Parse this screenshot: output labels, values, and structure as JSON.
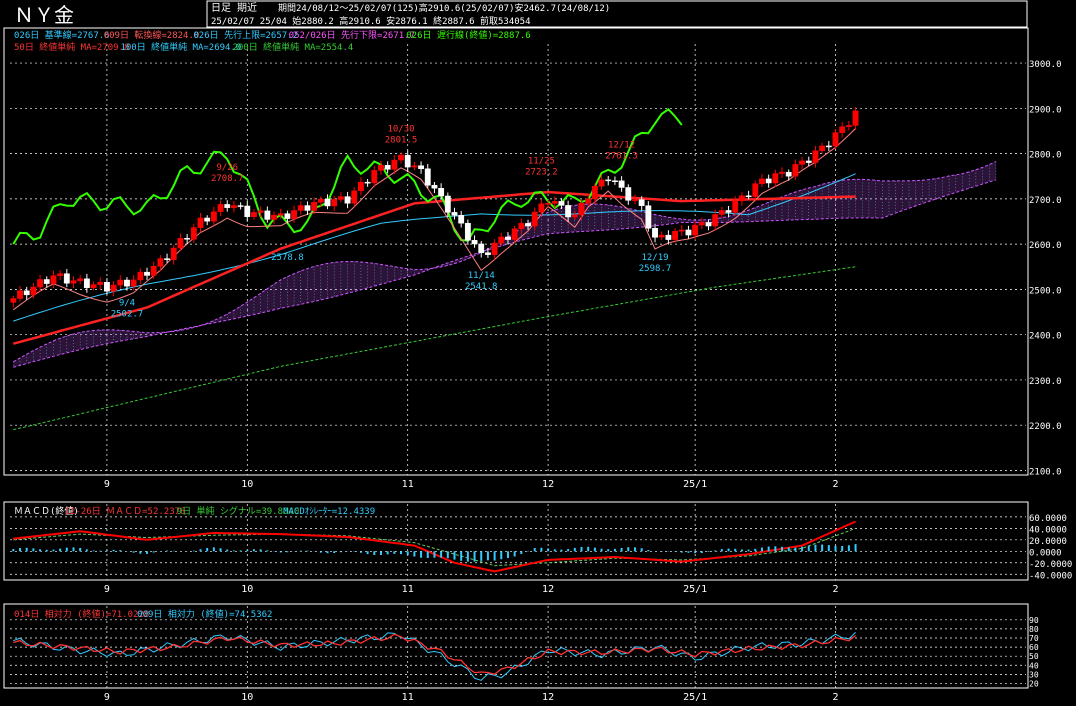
{
  "header": {
    "title": "ＮＹ金",
    "mode": "日足 期近",
    "line1": "期間24/08/12～25/02/07(125)高2910.6(25/02/07)安2462.7(24/08/12)",
    "line2": "25/02/07 25/04 始2880.2 高2910.6 安2876.1 終2887.6 前取534054"
  },
  "colors": {
    "background": "#000000",
    "grid": "#ffffff",
    "up_candle": "#ff0000",
    "down_candle": "#ffffff",
    "ma50": "#ff2222",
    "ma100": "#33ccff",
    "ma200": "#33cc33",
    "chikou": "#33ff00",
    "kijun": "#ff8080",
    "tenkan": "#33ffff",
    "cloud": "#cc55ff",
    "macd": "#ff0000",
    "signal": "#66cc66",
    "osc": "#33ccff",
    "rsi14": "#ff3333",
    "rsi9": "#33ccff"
  },
  "legend": {
    "row1": [
      {
        "text": "026日 基準線=2767.6",
        "color": "#33ccff"
      },
      {
        "text": "009日 転換線=2824.0",
        "color": "#ff5555"
      },
      {
        "text": "026日 先行上限=2657.2",
        "color": "#33ccff"
      },
      {
        "text": "052/026日 先行下限=2671.7",
        "color": "#ff55ff"
      },
      {
        "text": "026日 遅行線(終値)=2887.6",
        "color": "#33ff00"
      }
    ],
    "row2": [
      {
        "text": "50日 終値単純 MA=2709.8",
        "color": "#ff3333"
      },
      {
        "text": "100日 終値単純 MA=2694.0",
        "color": "#33ccff"
      },
      {
        "text": "200日 終値単純 MA=2554.4",
        "color": "#33cc33"
      }
    ]
  },
  "macd_legend": [
    {
      "text": "ＭＡＣＤ(終値)",
      "color": "#ffffff"
    },
    {
      "text": "12-26日 ＭＡＣＤ=52.2378",
      "color": "#ff3333"
    },
    {
      "text": "9日 単純 シグナル=39.8040",
      "color": "#33cc33"
    },
    {
      "text": "MACDｵｼﾚｰﾀｰ=12.4339",
      "color": "#33ccff"
    }
  ],
  "rsi_legend": [
    {
      "text": "014日 相対力 (終値)=71.0228",
      "color": "#ff3333"
    },
    {
      "text": "009日 相対力 (終値)=74.5362",
      "color": "#33ccff"
    }
  ],
  "chart_data": {
    "type": "candlestick",
    "x_labels": [
      {
        "label": "9",
        "index": 14
      },
      {
        "label": "10",
        "index": 35
      },
      {
        "label": "11",
        "index": 59
      },
      {
        "label": "12",
        "index": 80
      },
      {
        "label": "25/1",
        "index": 102
      },
      {
        "label": "2",
        "index": 123
      }
    ],
    "price_ticks": [
      3000,
      2900,
      2800,
      2700,
      2600,
      2500,
      2400,
      2300,
      2200,
      2100
    ],
    "price_tick_labels": [
      "3000.0",
      "2900.0",
      "2800.0",
      "2700.0",
      "2600.0",
      "2500.0",
      "2400.0",
      "2300.0",
      "2200.0",
      "2100.0"
    ],
    "price_range": [
      2090,
      3020
    ],
    "candle_anchors": [
      [
        0,
        2480
      ],
      [
        6,
        2530
      ],
      [
        10,
        2515
      ],
      [
        14,
        2505
      ],
      [
        18,
        2520
      ],
      [
        22,
        2560
      ],
      [
        28,
        2650
      ],
      [
        32,
        2690
      ],
      [
        35,
        2670
      ],
      [
        40,
        2660
      ],
      [
        45,
        2690
      ],
      [
        50,
        2700
      ],
      [
        54,
        2760
      ],
      [
        58,
        2790
      ],
      [
        61,
        2760
      ],
      [
        64,
        2700
      ],
      [
        67,
        2640
      ],
      [
        70,
        2575
      ],
      [
        73,
        2610
      ],
      [
        77,
        2650
      ],
      [
        80,
        2700
      ],
      [
        84,
        2660
      ],
      [
        86,
        2710
      ],
      [
        89,
        2750
      ],
      [
        91,
        2720
      ],
      [
        94,
        2680
      ],
      [
        96,
        2610
      ],
      [
        98,
        2620
      ],
      [
        101,
        2630
      ],
      [
        104,
        2650
      ],
      [
        108,
        2690
      ],
      [
        112,
        2740
      ],
      [
        116,
        2760
      ],
      [
        120,
        2800
      ],
      [
        123,
        2840
      ],
      [
        126,
        2888
      ]
    ],
    "ma50_anchors": [
      [
        0,
        2380
      ],
      [
        20,
        2460
      ],
      [
        40,
        2590
      ],
      [
        60,
        2690
      ],
      [
        80,
        2715
      ],
      [
        100,
        2695
      ],
      [
        126,
        2705
      ]
    ],
    "ma100_anchors": [
      [
        0,
        2430
      ],
      [
        20,
        2510
      ],
      [
        40,
        2580
      ],
      [
        55,
        2640
      ],
      [
        70,
        2670
      ],
      [
        90,
        2670
      ],
      [
        110,
        2665
      ],
      [
        126,
        2760
      ]
    ],
    "ma200_anchors": [
      [
        0,
        2190
      ],
      [
        40,
        2330
      ],
      [
        80,
        2440
      ],
      [
        105,
        2505
      ],
      [
        126,
        2550
      ]
    ],
    "chikou_anchors": [
      [
        0,
        2600
      ],
      [
        4,
        2630
      ],
      [
        8,
        2700
      ],
      [
        14,
        2690
      ],
      [
        20,
        2680
      ],
      [
        26,
        2760
      ],
      [
        32,
        2800
      ],
      [
        38,
        2650
      ],
      [
        44,
        2640
      ],
      [
        50,
        2780
      ],
      [
        56,
        2760
      ],
      [
        60,
        2730
      ],
      [
        64,
        2690
      ],
      [
        68,
        2600
      ],
      [
        72,
        2660
      ],
      [
        76,
        2700
      ],
      [
        80,
        2700
      ],
      [
        84,
        2690
      ],
      [
        88,
        2740
      ],
      [
        92,
        2800
      ],
      [
        96,
        2880
      ],
      [
        100,
        2880
      ]
    ],
    "cloud_upper": [
      [
        0,
        2340
      ],
      [
        20,
        2410
      ],
      [
        40,
        2510
      ],
      [
        60,
        2560
      ],
      [
        80,
        2650
      ],
      [
        100,
        2680
      ],
      [
        120,
        2700
      ],
      [
        130,
        2730
      ],
      [
        140,
        2780
      ],
      [
        147,
        2800
      ]
    ],
    "cloud_lower": [
      [
        0,
        2340
      ],
      [
        20,
        2400
      ],
      [
        40,
        2480
      ],
      [
        60,
        2540
      ],
      [
        80,
        2630
      ],
      [
        100,
        2670
      ],
      [
        120,
        2660
      ],
      [
        130,
        2660
      ],
      [
        140,
        2720
      ],
      [
        147,
        2760
      ]
    ],
    "annotations": [
      {
        "date": "9/26",
        "price": "2708.7",
        "index": 32,
        "at": 2715,
        "color": "#ff3333",
        "pos": "above"
      },
      {
        "date": "10/30",
        "price": "2801.5",
        "index": 58,
        "at": 2800,
        "color": "#ff3333",
        "pos": "above"
      },
      {
        "date": "11/25",
        "price": "2723.2",
        "index": 79,
        "at": 2730,
        "color": "#ff3333",
        "pos": "above"
      },
      {
        "date": "12/12",
        "price": "2761.3",
        "index": 91,
        "at": 2765,
        "color": "#ff3333",
        "pos": "above"
      },
      {
        "date": "9/4",
        "price": "2502.7",
        "index": 17,
        "at": 2500,
        "color": "#33ccff",
        "pos": "below"
      },
      {
        "date": "2578.8",
        "price": "",
        "index": 41,
        "at": 2600,
        "color": "#33ccff",
        "pos": "below"
      },
      {
        "date": "11/14",
        "price": "2541.8",
        "index": 70,
        "at": 2560,
        "color": "#33ccff",
        "pos": "below"
      },
      {
        "date": "12/19",
        "price": "2598.7",
        "index": 96,
        "at": 2600,
        "color": "#33ccff",
        "pos": "below"
      }
    ],
    "macd": {
      "ticks": [
        60,
        40,
        20,
        0,
        -20,
        -40
      ],
      "tick_labels": [
        "60.0000",
        "40.0000",
        "20.0000",
        "0.0000",
        "-20.0000",
        "-40.0000"
      ],
      "range": [
        -50,
        65
      ],
      "macd_anchors": [
        [
          0,
          22
        ],
        [
          10,
          35
        ],
        [
          20,
          20
        ],
        [
          30,
          32
        ],
        [
          40,
          30
        ],
        [
          50,
          25
        ],
        [
          60,
          10
        ],
        [
          66,
          -20
        ],
        [
          72,
          -35
        ],
        [
          80,
          -15
        ],
        [
          90,
          -10
        ],
        [
          100,
          -18
        ],
        [
          110,
          -5
        ],
        [
          118,
          10
        ],
        [
          126,
          52
        ]
      ],
      "signal_anchors": [
        [
          0,
          20
        ],
        [
          10,
          30
        ],
        [
          20,
          24
        ],
        [
          30,
          28
        ],
        [
          40,
          30
        ],
        [
          50,
          27
        ],
        [
          60,
          15
        ],
        [
          66,
          -5
        ],
        [
          72,
          -25
        ],
        [
          80,
          -20
        ],
        [
          90,
          -12
        ],
        [
          100,
          -15
        ],
        [
          110,
          -8
        ],
        [
          118,
          5
        ],
        [
          126,
          40
        ]
      ],
      "osc_anchors": [
        [
          0,
          4
        ],
        [
          10,
          5
        ],
        [
          20,
          -3
        ],
        [
          30,
          5
        ],
        [
          40,
          0
        ],
        [
          50,
          -2
        ],
        [
          60,
          -8
        ],
        [
          66,
          -15
        ],
        [
          72,
          -18
        ],
        [
          78,
          4
        ],
        [
          86,
          6
        ],
        [
          94,
          5
        ],
        [
          100,
          -4
        ],
        [
          108,
          4
        ],
        [
          118,
          9
        ],
        [
          126,
          12
        ]
      ]
    },
    "rsi": {
      "ticks": [
        90,
        80,
        70,
        60,
        50,
        40,
        30,
        20
      ],
      "tick_labels": [
        "90",
        "80",
        "70",
        "60",
        "50",
        "40",
        "30",
        "20"
      ],
      "range": [
        15,
        92
      ],
      "rsi14_anchors": [
        [
          0,
          65
        ],
        [
          8,
          60
        ],
        [
          16,
          55
        ],
        [
          24,
          60
        ],
        [
          32,
          70
        ],
        [
          40,
          62
        ],
        [
          48,
          64
        ],
        [
          58,
          72
        ],
        [
          64,
          55
        ],
        [
          70,
          30
        ],
        [
          74,
          36
        ],
        [
          80,
          55
        ],
        [
          88,
          54
        ],
        [
          96,
          58
        ],
        [
          102,
          52
        ],
        [
          110,
          58
        ],
        [
          118,
          62
        ],
        [
          126,
          71
        ]
      ],
      "rsi9_anchors": [
        [
          0,
          67
        ],
        [
          8,
          58
        ],
        [
          16,
          52
        ],
        [
          24,
          62
        ],
        [
          32,
          72
        ],
        [
          40,
          60
        ],
        [
          48,
          66
        ],
        [
          58,
          74
        ],
        [
          64,
          50
        ],
        [
          70,
          25
        ],
        [
          74,
          32
        ],
        [
          80,
          57
        ],
        [
          88,
          52
        ],
        [
          96,
          60
        ],
        [
          102,
          48
        ],
        [
          110,
          60
        ],
        [
          118,
          64
        ],
        [
          126,
          74
        ]
      ]
    }
  }
}
